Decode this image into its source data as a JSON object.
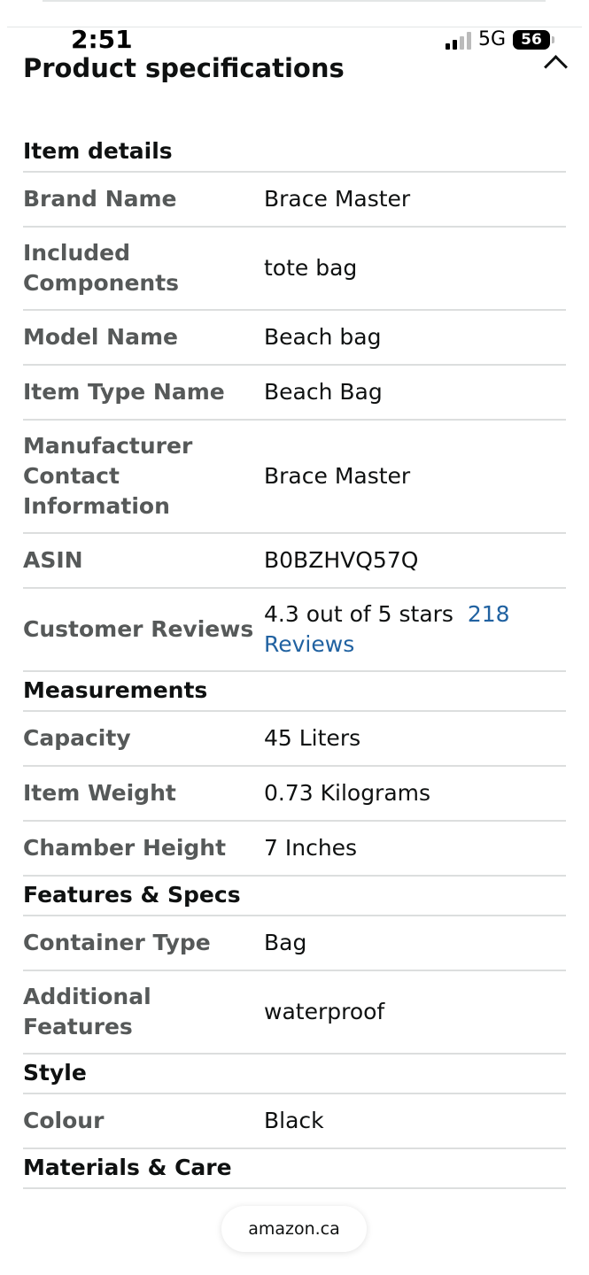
{
  "status_bar": {
    "time": "2:51",
    "network": "5G",
    "battery": "56"
  },
  "header": {
    "title": "Product specifications"
  },
  "sections": {
    "item_details": {
      "heading": "Item details",
      "rows": [
        {
          "label": "Brand Name",
          "value": "Brace Master"
        },
        {
          "label": "Included Components",
          "value": "tote bag"
        },
        {
          "label": "Model Name",
          "value": "Beach bag"
        },
        {
          "label": "Item Type Name",
          "value": "Beach Bag"
        },
        {
          "label": "Manufacturer Contact Information",
          "value": "Brace Master"
        },
        {
          "label": "ASIN",
          "value": "B0BZHVQ57Q"
        },
        {
          "label": "Customer Reviews",
          "value": "4.3 out of 5 stars",
          "link": "218 Reviews"
        }
      ]
    },
    "measurements": {
      "heading": "Measurements",
      "rows": [
        {
          "label": "Capacity",
          "value": "45 Liters"
        },
        {
          "label": "Item Weight",
          "value": "0.73 Kilograms"
        },
        {
          "label": "Chamber Height",
          "value": "7 Inches"
        }
      ]
    },
    "features": {
      "heading": "Features & Specs",
      "rows": [
        {
          "label": "Container Type",
          "value": "Bag"
        },
        {
          "label": "Additional Features",
          "value": "waterproof"
        }
      ]
    },
    "style": {
      "heading": "Style",
      "rows": [
        {
          "label": "Colour",
          "value": "Black"
        }
      ]
    },
    "materials": {
      "heading": "Materials & Care"
    }
  },
  "footer": {
    "domain": "amazon.ca"
  }
}
